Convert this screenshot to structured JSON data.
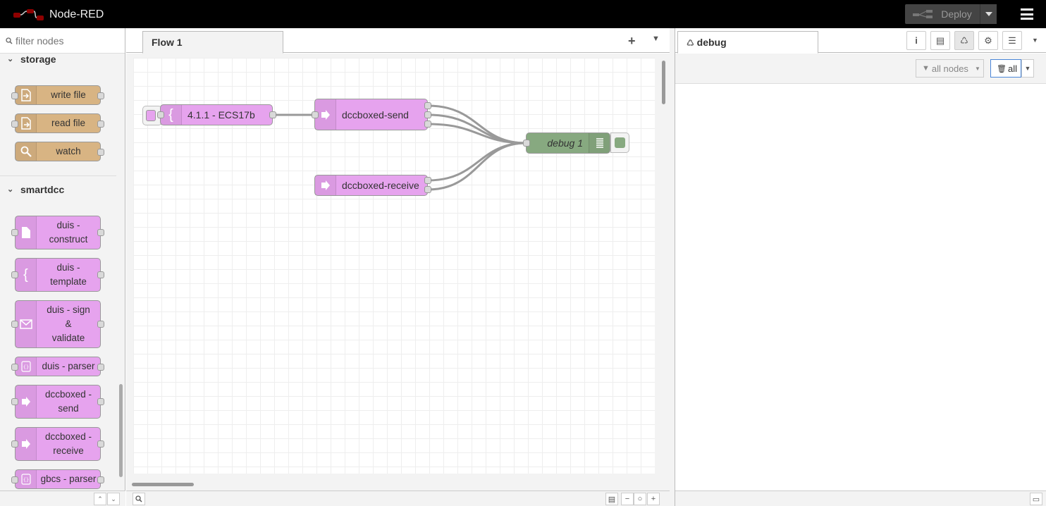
{
  "header": {
    "app_title": "Node-RED",
    "deploy_label": "Deploy"
  },
  "palette": {
    "search_placeholder": "filter nodes",
    "categories": [
      {
        "name": "storage",
        "nodes": [
          "write file",
          "read file",
          "watch"
        ]
      },
      {
        "name": "smartdcc",
        "nodes": [
          "duis - construct",
          "duis - template",
          "duis - sign & validate",
          "duis - parser",
          "dccboxed - send",
          "dccboxed - receive",
          "gbcs - parser"
        ]
      }
    ],
    "node_lines": {
      "duis_construct": [
        "duis -",
        "construct"
      ],
      "duis_template": [
        "duis -",
        "template"
      ],
      "duis_sign": [
        "duis - sign",
        "&",
        "validate"
      ],
      "duis_parser": "duis - parser",
      "dccboxed_send": [
        "dccboxed -",
        "send"
      ],
      "dccboxed_receive": [
        "dccboxed -",
        "receive"
      ],
      "gbcs_parser": "gbcs - parser"
    }
  },
  "workspace": {
    "tabs": [
      {
        "label": "Flow 1"
      }
    ],
    "nodes": {
      "template": "4.1.1 - ECS17b",
      "send": "dccboxed-send",
      "receive": "dccboxed-receive",
      "debug": "debug 1"
    }
  },
  "sidebar": {
    "active_tab": "debug",
    "filter_label": "all nodes",
    "clear_label": "all"
  },
  "colors": {
    "storage_node": "#d8b483",
    "smartdcc_node": "#e6a3ee",
    "debug_node": "#87a980",
    "header_bg": "#000000"
  }
}
